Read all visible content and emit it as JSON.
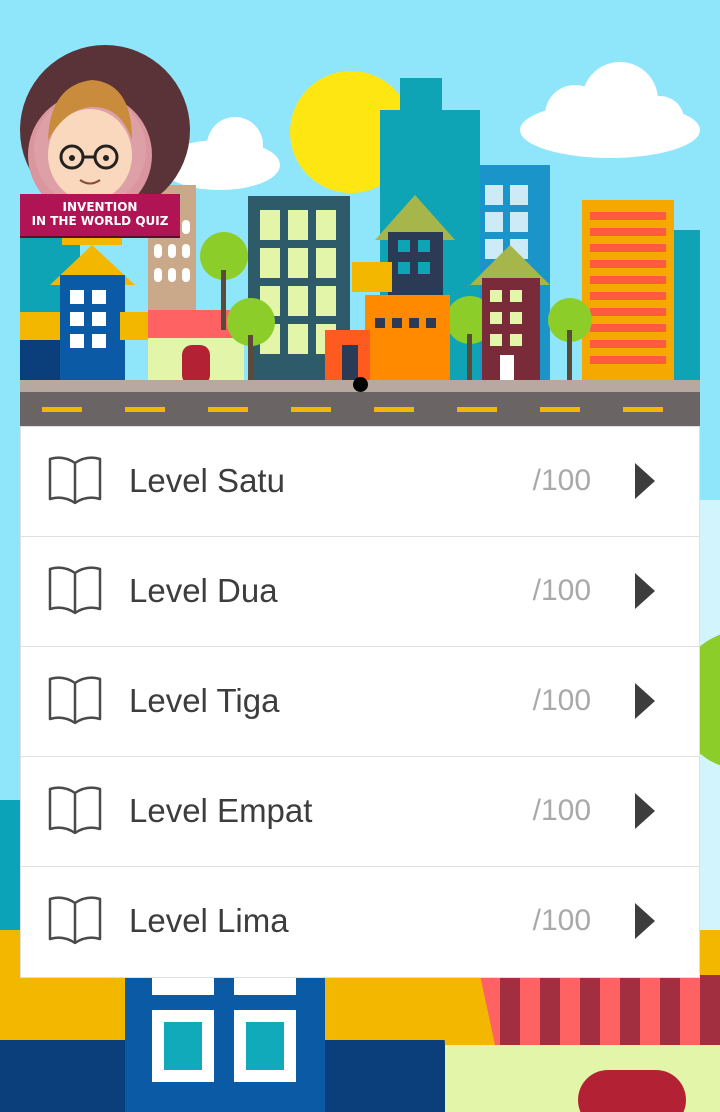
{
  "app": {
    "logo_line1": "INVENTION",
    "logo_line2": "IN THE WORLD QUIZ"
  },
  "levels": [
    {
      "label": "Level Satu",
      "score": "/100",
      "icon": "book-icon"
    },
    {
      "label": "Level Dua",
      "score": "/100",
      "icon": "book-icon"
    },
    {
      "label": "Level Tiga",
      "score": "/100",
      "icon": "book-icon"
    },
    {
      "label": "Level Empat",
      "score": "/100",
      "icon": "book-icon"
    },
    {
      "label": "Level Lima",
      "score": "/100",
      "icon": "book-icon"
    }
  ],
  "colors": {
    "sky": "#8fe6fb",
    "sun": "#fde611",
    "road": "#6b6464",
    "text": "#3d3d3d",
    "score": "#a9a9a9"
  }
}
